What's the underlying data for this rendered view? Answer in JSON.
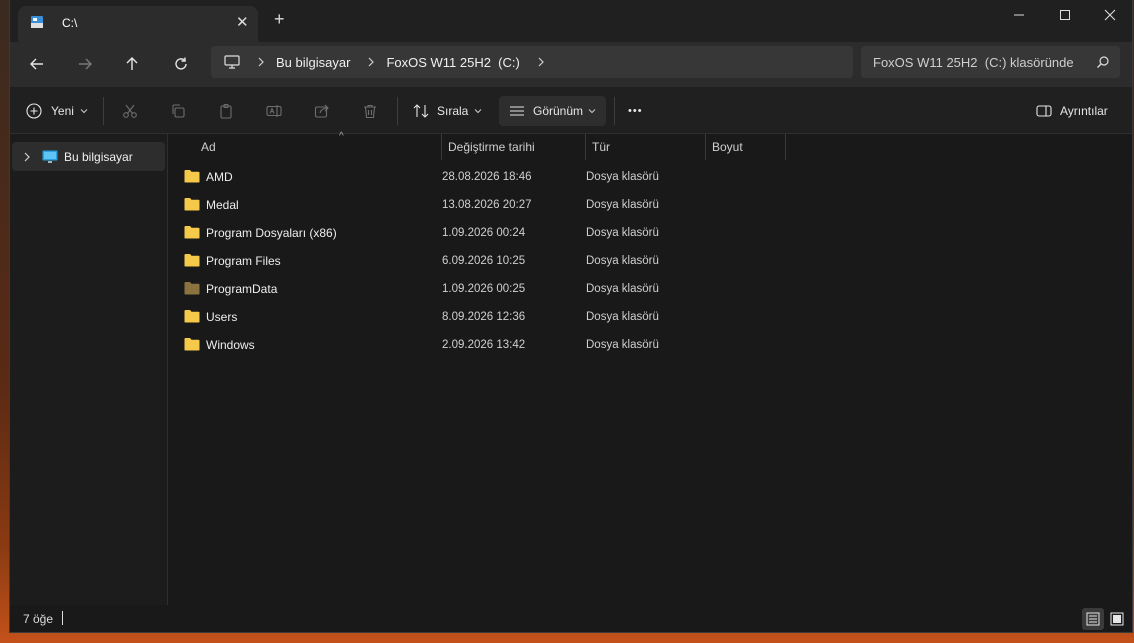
{
  "window": {
    "tab_title": "C:\\",
    "new_tab_label": "+",
    "tab_close_label": "✕",
    "controls": {
      "minimize": "—",
      "maximize": "☐",
      "close": "✕"
    }
  },
  "address": {
    "breadcrumbs": [
      "Bu bilgisayar",
      "FoxOS W11 25H2  (C:)"
    ],
    "search_placeholder": "FoxOS W11 25H2  (C:) klasöründe"
  },
  "toolbar": {
    "new_label": "Yeni",
    "sort_label": "Sırala",
    "view_label": "Görünüm",
    "more_label": "•••",
    "details_label": "Ayrıntılar"
  },
  "sidebar": {
    "items": [
      {
        "label": "Bu bilgisayar",
        "icon": "computer-icon"
      }
    ]
  },
  "columns": {
    "name": "Ad",
    "modified": "Değiştirme tarihi",
    "type": "Tür",
    "size": "Boyut"
  },
  "files": [
    {
      "name": "AMD",
      "modified": "28.08.2026 18:46",
      "type": "Dosya klasörü",
      "icon": "folder-icon"
    },
    {
      "name": "Medal",
      "modified": "13.08.2026 20:27",
      "type": "Dosya klasörü",
      "icon": "folder-icon"
    },
    {
      "name": "Program Dosyaları (x86)",
      "modified": "1.09.2026 00:24",
      "type": "Dosya klasörü",
      "icon": "folder-icon"
    },
    {
      "name": "Program Files",
      "modified": "6.09.2026 10:25",
      "type": "Dosya klasörü",
      "icon": "folder-icon"
    },
    {
      "name": "ProgramData",
      "modified": "1.09.2026 00:25",
      "type": "Dosya klasörü",
      "icon": "hidden-folder-icon"
    },
    {
      "name": "Users",
      "modified": "8.09.2026 12:36",
      "type": "Dosya klasörü",
      "icon": "folder-icon"
    },
    {
      "name": "Windows",
      "modified": "2.09.2026 13:42",
      "type": "Dosya klasörü",
      "icon": "folder-icon"
    }
  ],
  "status": {
    "count": "7 öğe"
  },
  "colors": {
    "folder": "#f5c94a",
    "folder_hidden": "#8a7340",
    "accent": "#2aa0e0",
    "background": "#191919"
  }
}
